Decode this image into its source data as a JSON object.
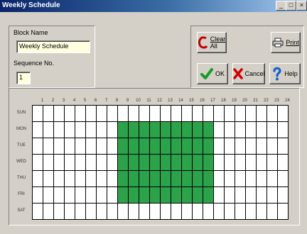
{
  "window": {
    "title": "Weekly Schedule",
    "controls": {
      "minimize": "_",
      "maximize": "□",
      "close": "×"
    }
  },
  "block_name": {
    "label": "Block Name",
    "value": "Weekly Schedule"
  },
  "sequence": {
    "label": "Sequence No.",
    "value": "1"
  },
  "buttons": {
    "clear_all": {
      "label_line1": "Clear",
      "label_line2": "All",
      "icon": "clear-icon"
    },
    "print": {
      "label": "Print",
      "icon": "printer-icon"
    },
    "ok": {
      "label": "OK",
      "icon": "checkmark-icon"
    },
    "cancel": {
      "label": "Cancel",
      "icon": "cross-icon"
    },
    "help": {
      "label": "Help",
      "icon": "question-icon"
    }
  },
  "grid": {
    "hours": [
      "1",
      "2",
      "3",
      "4",
      "5",
      "6",
      "7",
      "8",
      "9",
      "10",
      "11",
      "12",
      "13",
      "14",
      "15",
      "16",
      "17",
      "18",
      "19",
      "20",
      "21",
      "22",
      "23",
      "24"
    ],
    "days": [
      "SUN",
      "MON",
      "TUE",
      "WED",
      "THU",
      "FRI",
      "SAT"
    ],
    "active_days": [
      "MON",
      "TUE",
      "WED",
      "THU",
      "FRI"
    ],
    "active_from_hour": 8,
    "active_to_hour": 16,
    "active_color": "#2ca34a"
  }
}
